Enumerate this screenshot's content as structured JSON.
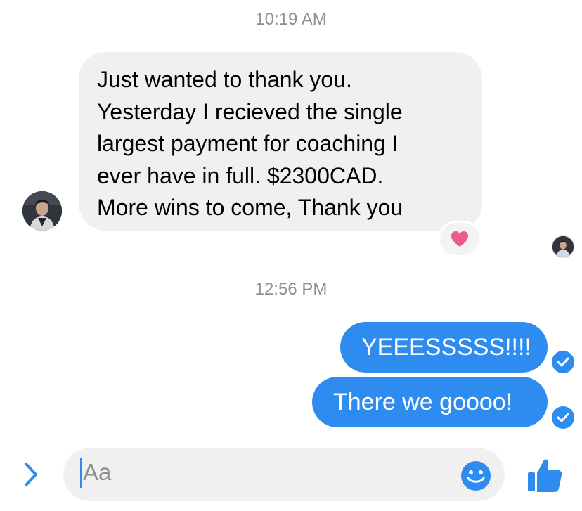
{
  "thread": {
    "timestamp_1": "10:19 AM",
    "incoming": {
      "lines": [
        "Just wanted to thank you.",
        "Yesterday I recieved the single",
        "largest payment for coaching I",
        "ever have in full. $2300CAD.",
        "More wins to come, Thank you"
      ],
      "reaction_icon": "heart-icon",
      "reaction_color": "#ee5a8c"
    },
    "timestamp_2": "12:56 PM",
    "outgoing": [
      {
        "text": "YEEESSSSS!!!!",
        "status_icon": "check-circle-icon"
      },
      {
        "text": "There we goooo!",
        "status_icon": "check-circle-icon"
      }
    ]
  },
  "composer": {
    "placeholder": "Aa",
    "icons": [
      "chevron-right-icon",
      "smiley-icon",
      "thumbs-up-icon"
    ]
  },
  "colors": {
    "accent": "#2e8cf0",
    "incoming_bubble": "#f1f0f0",
    "timestamp": "#8e8e93"
  }
}
